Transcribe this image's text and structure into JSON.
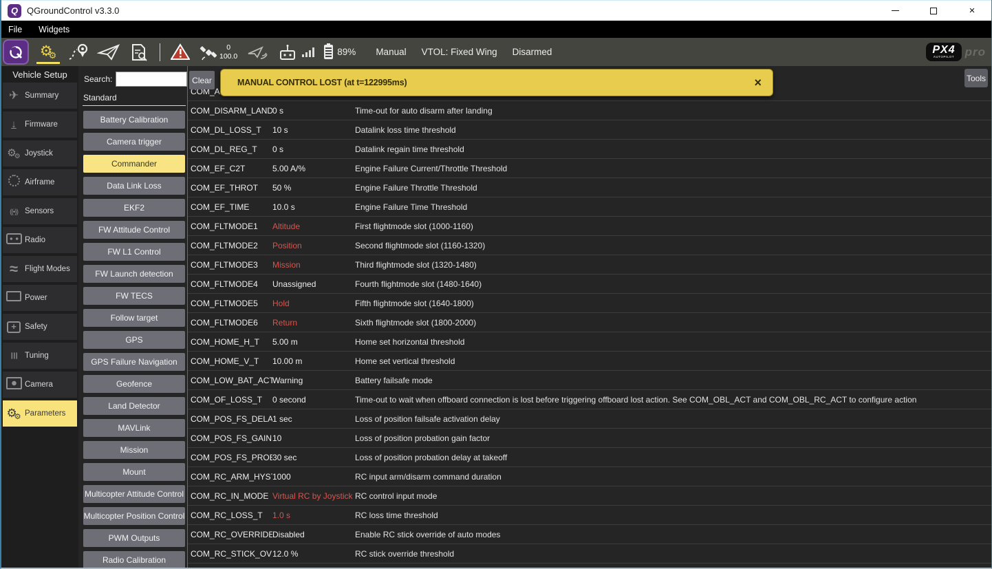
{
  "window": {
    "title": "QGroundControl v3.3.0"
  },
  "menubar": {
    "items": [
      "File",
      "Widgets"
    ]
  },
  "toolbar": {
    "gps_count": "0",
    "gps_hdop": "100.0",
    "battery_pct": "89%",
    "flight_mode": "Manual",
    "vtol_state": "VTOL: Fixed Wing",
    "armed_state": "Disarmed",
    "brand_main": "PX4",
    "brand_sub": "AUTOPILOT",
    "brand_pro": "pro"
  },
  "sidebar": {
    "header": "Vehicle Setup",
    "items": [
      {
        "label": "Summary",
        "icon": "summary"
      },
      {
        "label": "Firmware",
        "icon": "firmware"
      },
      {
        "label": "Joystick",
        "icon": "joystick"
      },
      {
        "label": "Airframe",
        "icon": "airframe"
      },
      {
        "label": "Sensors",
        "icon": "sensors"
      },
      {
        "label": "Radio",
        "icon": "radio"
      },
      {
        "label": "Flight Modes",
        "icon": "flightmodes"
      },
      {
        "label": "Power",
        "icon": "power"
      },
      {
        "label": "Safety",
        "icon": "safety"
      },
      {
        "label": "Tuning",
        "icon": "tuning"
      },
      {
        "label": "Camera",
        "icon": "camera"
      },
      {
        "label": "Parameters",
        "icon": "parameters",
        "selected": true
      }
    ]
  },
  "groups": {
    "search_label": "Search:",
    "search_value": "",
    "clear_label": "Clear",
    "section_label": "Standard",
    "items": [
      {
        "label": "Battery Calibration"
      },
      {
        "label": "Camera trigger"
      },
      {
        "label": "Commander",
        "selected": true
      },
      {
        "label": "Data Link Loss"
      },
      {
        "label": "EKF2"
      },
      {
        "label": "FW Attitude Control"
      },
      {
        "label": "FW L1 Control"
      },
      {
        "label": "FW Launch detection"
      },
      {
        "label": "FW TECS"
      },
      {
        "label": "Follow target"
      },
      {
        "label": "GPS"
      },
      {
        "label": "GPS Failure Navigation"
      },
      {
        "label": "Geofence"
      },
      {
        "label": "Land Detector"
      },
      {
        "label": "MAVLink"
      },
      {
        "label": "Mission"
      },
      {
        "label": "Mount"
      },
      {
        "label": "Multicopter Attitude Control"
      },
      {
        "label": "Multicopter Position Control"
      },
      {
        "label": "PWM Outputs"
      },
      {
        "label": "Radio Calibration"
      }
    ]
  },
  "banner": {
    "text": "MANUAL CONTROL LOST (at t=122995ms)",
    "close": "×"
  },
  "tools_label": "Tools",
  "table": {
    "partial_row_name": "COM_ARM",
    "rows": [
      {
        "name": "COM_DISARM_LAND",
        "value": "0 s",
        "desc": "Time-out for auto disarm after landing"
      },
      {
        "name": "COM_DL_LOSS_T",
        "value": "10 s",
        "desc": "Datalink loss time threshold"
      },
      {
        "name": "COM_DL_REG_T",
        "value": "0 s",
        "desc": "Datalink regain time threshold"
      },
      {
        "name": "COM_EF_C2T",
        "value": "5.00 A/%",
        "desc": "Engine Failure Current/Throttle Threshold"
      },
      {
        "name": "COM_EF_THROT",
        "value": "50 %",
        "desc": "Engine Failure Throttle Threshold"
      },
      {
        "name": "COM_EF_TIME",
        "value": "10.0 s",
        "desc": "Engine Failure Time Threshold"
      },
      {
        "name": "COM_FLTMODE1",
        "value": "Altitude",
        "desc": "First flightmode slot (1000-1160)",
        "red": true
      },
      {
        "name": "COM_FLTMODE2",
        "value": "Position",
        "desc": "Second flightmode slot (1160-1320)",
        "red": true
      },
      {
        "name": "COM_FLTMODE3",
        "value": "Mission",
        "desc": "Third flightmode slot (1320-1480)",
        "red": true
      },
      {
        "name": "COM_FLTMODE4",
        "value": "Unassigned",
        "desc": "Fourth flightmode slot (1480-1640)"
      },
      {
        "name": "COM_FLTMODE5",
        "value": "Hold",
        "desc": "Fifth flightmode slot (1640-1800)",
        "red": true
      },
      {
        "name": "COM_FLTMODE6",
        "value": "Return",
        "desc": "Sixth flightmode slot (1800-2000)",
        "red": true
      },
      {
        "name": "COM_HOME_H_T",
        "value": "5.00 m",
        "desc": "Home set horizontal threshold"
      },
      {
        "name": "COM_HOME_V_T",
        "value": "10.00 m",
        "desc": "Home set vertical threshold"
      },
      {
        "name": "COM_LOW_BAT_ACT",
        "value": "Warning",
        "desc": "Battery failsafe mode"
      },
      {
        "name": "COM_OF_LOSS_T",
        "value": "0 second",
        "desc": "Time-out to wait when offboard connection is lost before triggering offboard lost action. See COM_OBL_ACT and COM_OBL_RC_ACT to configure action"
      },
      {
        "name": "COM_POS_FS_DELAY",
        "value": "1 sec",
        "desc": "Loss of position failsafe activation delay"
      },
      {
        "name": "COM_POS_FS_GAIN",
        "value": "10",
        "desc": "Loss of position probation gain factor"
      },
      {
        "name": "COM_POS_FS_PROB",
        "value": "30 sec",
        "desc": "Loss of position probation delay at takeoff"
      },
      {
        "name": "COM_RC_ARM_HYST",
        "value": "1000",
        "desc": "RC input arm/disarm command duration"
      },
      {
        "name": "COM_RC_IN_MODE",
        "value": "Virtual RC by Joystick",
        "desc": "RC control input mode",
        "red": true
      },
      {
        "name": "COM_RC_LOSS_T",
        "value": "1.0 s",
        "desc": "RC loss time threshold",
        "red": true
      },
      {
        "name": "COM_RC_OVERRIDE",
        "value": "Disabled",
        "desc": "Enable RC stick override of auto modes"
      },
      {
        "name": "COM_RC_STICK_OV",
        "value": "12.0 %",
        "desc": "RC stick override threshold"
      }
    ]
  },
  "colors": {
    "accent_yellow": "#f8e27b",
    "banner_yellow": "#e7cc4e",
    "error_red": "#d9544c",
    "brand_purple": "#5c2d84",
    "toolbar_bg": "#454540"
  }
}
